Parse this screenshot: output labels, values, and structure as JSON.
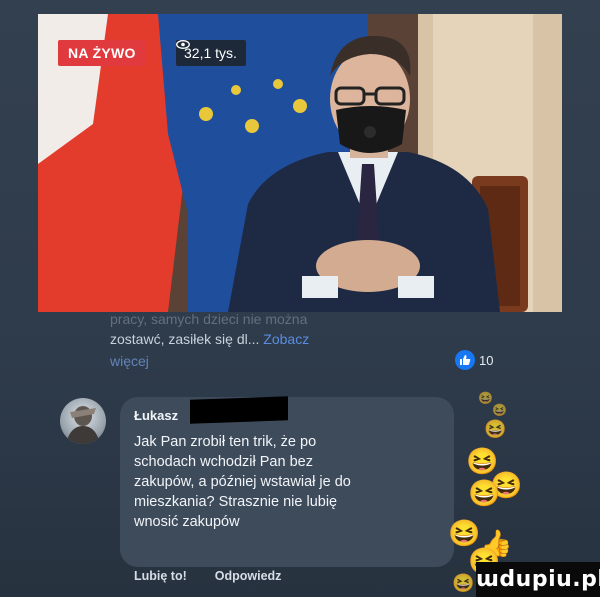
{
  "video": {
    "live_badge": "NA ŻYWO",
    "viewers_icon": "eye-icon",
    "viewers_count": "32,1 tys."
  },
  "post": {
    "faded_line": "pracy, samych dzieci nie można",
    "line1": "zostawć, zasiłek się dl...",
    "see_more_1": "Zobacz",
    "see_more_2": "więcej",
    "reaction_count": "10"
  },
  "comment": {
    "author": "Łukasz",
    "lines": [
      "Jak Pan zrobił ten trik, że po",
      "schodach wchodził Pan bez",
      "zakupów, a później wstawiał je do",
      "mieszkania? Strasznie nie lubię",
      "wnosić zakupów"
    ],
    "like_action": "Lubię to!",
    "reply_action": "Odpowiedz"
  },
  "reactions": [
    "laughing-emoji",
    "laughing-emoji",
    "laughing-emoji",
    "like-emoji"
  ],
  "watermark": "ɯdupiu.pl",
  "colors": {
    "live_red": "#e13a3e",
    "link_blue": "#5a8de0",
    "bubble": "#3e4b5b",
    "background": "#2e3b4b"
  }
}
